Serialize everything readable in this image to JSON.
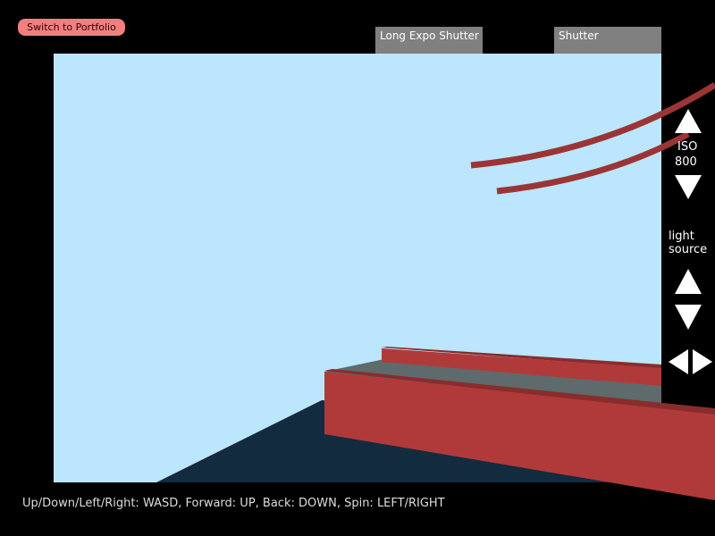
{
  "top": {
    "portfolio_button": "Switch to Portfolio",
    "tabs": [
      "Long Expo Shutter",
      "Shutter"
    ]
  },
  "sidebar": {
    "iso_label": "ISO",
    "iso_value": "800",
    "light_label_line1": "light",
    "light_label_line2": "source"
  },
  "help_text": "Up/Down/Left/Right: WASD, Forward: UP, Back: DOWN, Spin: LEFT/RIGHT",
  "colors": {
    "sky": "#bce6fe",
    "ground": "#132b3f",
    "beam": "#b03a3a",
    "walkway": "#5e6a6c",
    "portfolio_button": "#f08080",
    "tab": "#808080"
  }
}
